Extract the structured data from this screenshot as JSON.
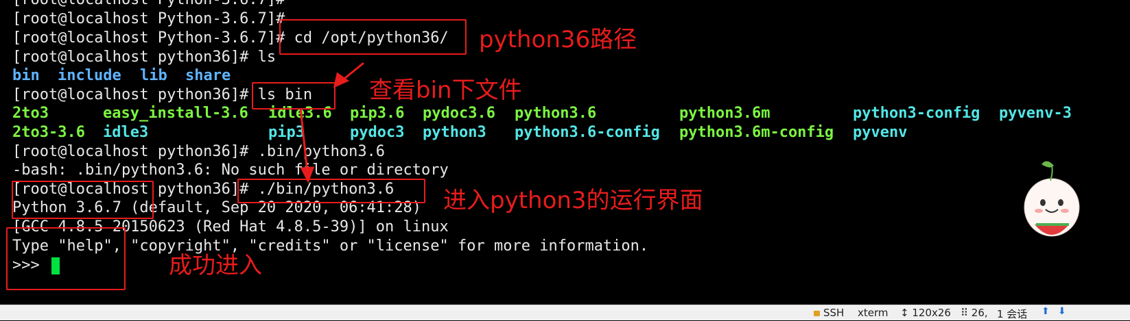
{
  "terminal": {
    "lines": [
      {
        "text": "[root@localhost Python-3.6.7]#"
      },
      {
        "text": "[root@localhost Python-3.6.7]#"
      },
      {
        "text": "[root@localhost Python-3.6.7]# cd /opt/python36/"
      },
      {
        "text": "[root@localhost python36]# ls"
      },
      {
        "items": [
          "bin",
          "include",
          "lib",
          "share"
        ]
      },
      {
        "text": "[root@localhost python36]# ls bin"
      },
      {
        "cols": [
          "2to3",
          "easy_install-3.6",
          "idle3.6",
          "pip3.6",
          "pydoc3.6",
          "python3.6",
          "python3.6m",
          "python3-config",
          "pyvenv-3"
        ]
      },
      {
        "cols": [
          "2to3-3.6",
          "idle3",
          "pip3",
          "pydoc3",
          "python3",
          "python3.6-config",
          "python3.6m-config",
          "pyvenv"
        ]
      },
      {
        "text": "[root@localhost python36]# .bin/python3.6"
      },
      {
        "text": "-bash: .bin/python3.6: No such file or directory"
      },
      {
        "text": "[root@localhost python36]# ./bin/python3.6"
      },
      {
        "text": "Python 3.6.7 (default, Sep 20 2020, 06:41:28)"
      },
      {
        "text": "[GCC 4.8.5 20150623 (Red Hat 4.8.5-39)] on linux"
      },
      {
        "text": "Type \"help\", \"copyright\", \"credits\" or \"license\" for more information."
      },
      {
        "text": ">>> "
      }
    ],
    "colors": {
      "dir": "#5fb4ff",
      "exec": "#7cf542",
      "link": "#54e6e6",
      "cursor": "#00e040",
      "annotation": "#e81c1c"
    }
  },
  "annotations": {
    "path_note": "python36路径",
    "bin_note": "查看bin下文件",
    "run_note": "进入python3的运行界面",
    "success_note": "成功进入"
  },
  "status": {
    "protocol": "SSH",
    "term_type": "xterm",
    "size": "120x26",
    "cursor_pos": "26,",
    "sessions": "1 会话"
  }
}
